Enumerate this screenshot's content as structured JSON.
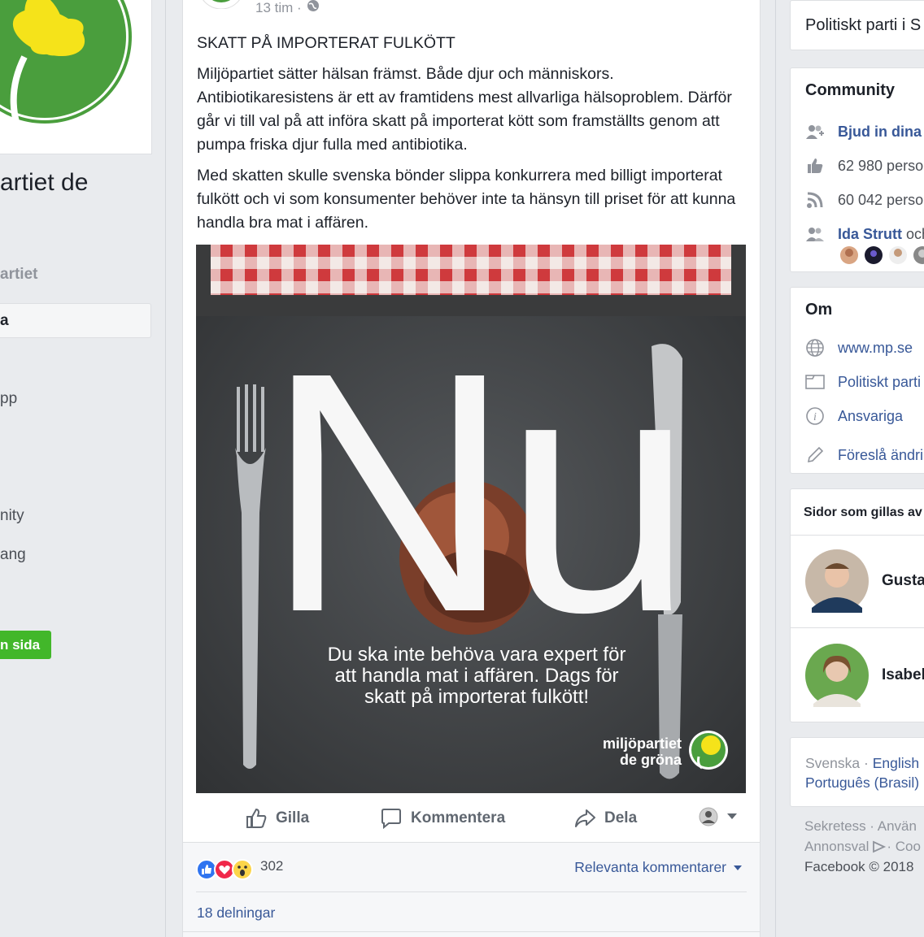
{
  "left": {
    "page_name_partial": "artiet de",
    "username_partial": "artiet",
    "nav_active_partial": "a",
    "nav_items": [
      "pp",
      "nity",
      "ang"
    ],
    "create_page_partial": "n sida"
  },
  "post": {
    "time": "13 tim ·",
    "title": "SKATT PÅ IMPORTERAT FULKÖTT",
    "paragraphs": [
      "Miljöpartiet sätter hälsan främst. Både djur och människors. Antibiotikaresistens är ett av framtidens mest allvarliga hälsoproblem. Därför går vi till val på att införa skatt på importerat kött som framställts genom att pumpa friska djur fulla med antibiotika.",
      "Med skatten skulle svenska bönder slippa konkurrera med billigt importerat fulkött och vi som konsumenter behöver inte ta hänsyn till priset för att kunna handla bra mat i affären."
    ],
    "image": {
      "big_text": "Nu",
      "caption_lines": [
        "Du ska inte behöva vara expert för",
        "att handla mat i affären. Dags för",
        "skatt på importerat fulkött!"
      ],
      "logo_lines": [
        "miljöpartiet",
        "de gröna"
      ]
    },
    "actions": {
      "like": "Gilla",
      "comment": "Kommentera",
      "share": "Dela"
    },
    "reaction_count": "302",
    "relevant_comments": "Relevanta kommentarer",
    "shares": "18 delningar"
  },
  "right": {
    "category_partial": "Politiskt parti i S",
    "community": {
      "title": "Community",
      "invite": "Bjud in dina",
      "likes": "62 980 perso",
      "follows": "60 042 perso",
      "friend": "Ida Strutt",
      "friend_suffix": " och"
    },
    "about": {
      "title": "Om",
      "website": "www.mp.se",
      "category": "Politiskt parti",
      "responsible": "Ansvariga",
      "suggest": "Föreslå ändri"
    },
    "liked_pages": {
      "title": "Sidor som gillas av",
      "pages": [
        "Gusta",
        "Isabel"
      ]
    },
    "languages": {
      "current": "Svenska",
      "sep": " · ",
      "english": "English",
      "portuguese": "Português (Brasil)"
    },
    "footer": {
      "line1": "Sekretess · Använ",
      "line2": "Annonsval",
      "line2_suffix": " · Coo",
      "copyright": "Facebook © 2018"
    }
  },
  "colors": {
    "link": "#385898",
    "green_button": "#42b72a",
    "mp_green": "#4a9e3d",
    "dandelion_yellow": "#f5e31a"
  }
}
